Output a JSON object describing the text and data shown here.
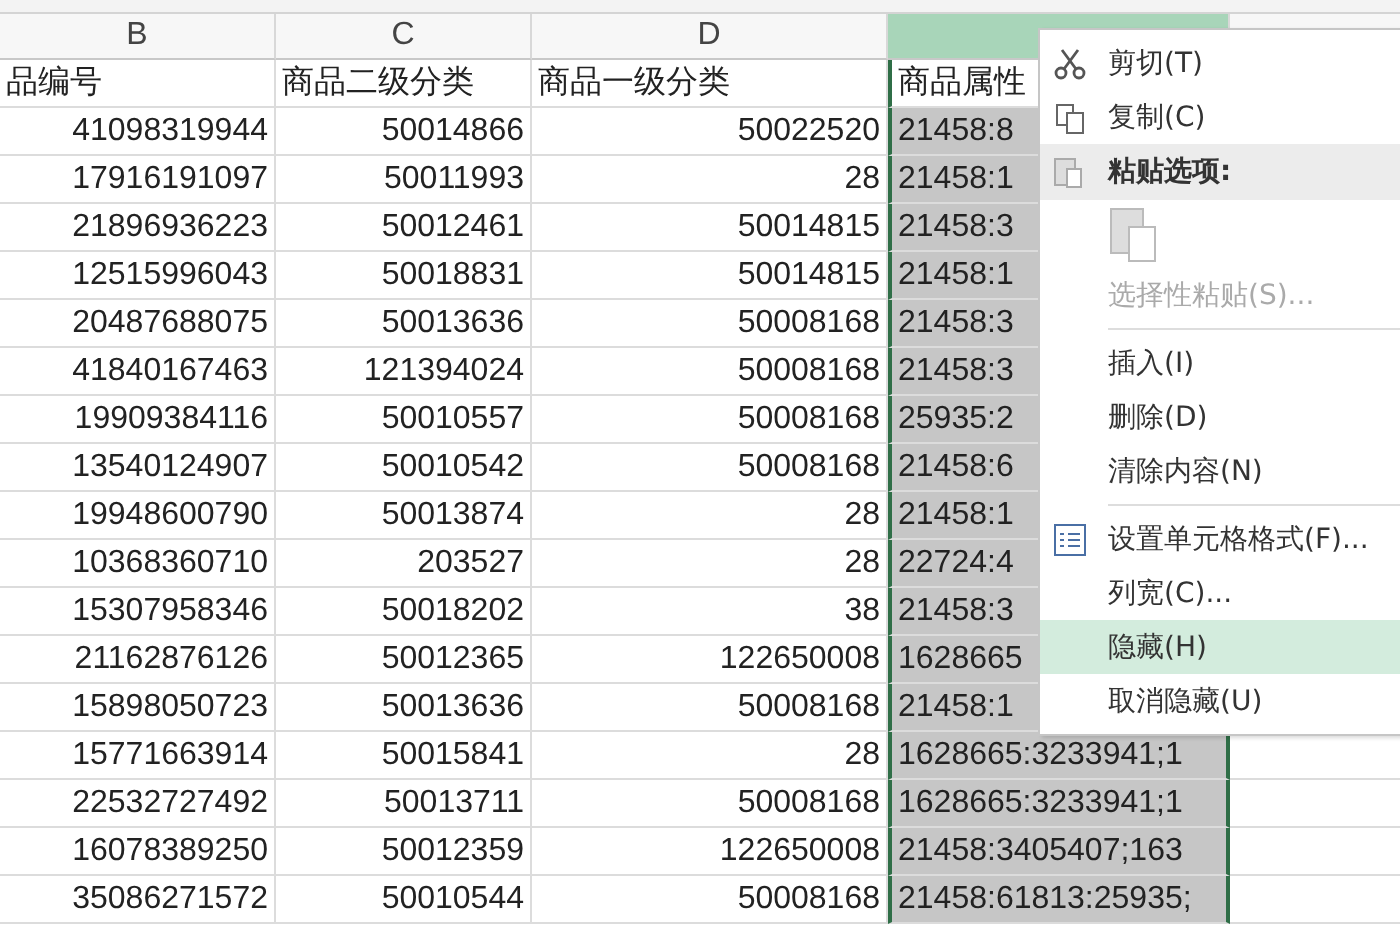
{
  "columns": [
    {
      "letter": "B",
      "selected": false
    },
    {
      "letter": "C",
      "selected": false
    },
    {
      "letter": "D",
      "selected": false
    },
    {
      "selected": true
    }
  ],
  "header_row": [
    "品编号",
    "商品二级分类",
    "商品一级分类",
    "商品属性"
  ],
  "rows": [
    [
      "41098319944",
      "50014866",
      "50022520",
      "21458:8"
    ],
    [
      "17916191097",
      "50011993",
      "28",
      "21458:1"
    ],
    [
      "21896936223",
      "50012461",
      "50014815",
      "21458:3"
    ],
    [
      "12515996043",
      "50018831",
      "50014815",
      "21458:1"
    ],
    [
      "20487688075",
      "50013636",
      "50008168",
      "21458:3"
    ],
    [
      "41840167463",
      "121394024",
      "50008168",
      "21458:3"
    ],
    [
      "19909384116",
      "50010557",
      "50008168",
      "25935:2"
    ],
    [
      "13540124907",
      "50010542",
      "50008168",
      "21458:6"
    ],
    [
      "19948600790",
      "50013874",
      "28",
      "21458:1"
    ],
    [
      "10368360710",
      "203527",
      "28",
      "22724:4"
    ],
    [
      "15307958346",
      "50018202",
      "38",
      "21458:3"
    ],
    [
      "21162876126",
      "50012365",
      "122650008",
      "1628665"
    ],
    [
      "15898050723",
      "50013636",
      "50008168",
      "21458:1"
    ],
    [
      "15771663914",
      "50015841",
      "28",
      "1628665:3233941;1"
    ],
    [
      "22532727492",
      "50013711",
      "50008168",
      "1628665:3233941;1"
    ],
    [
      "16078389250",
      "50012359",
      "122650008",
      "21458:3405407;163"
    ],
    [
      "35086271572",
      "50010544",
      "50008168",
      "21458:61813:25935;"
    ]
  ],
  "context_menu": [
    {
      "kind": "cut",
      "label": "剪切(T)",
      "disabled": false,
      "highlighted": false
    },
    {
      "kind": "copy",
      "label": "复制(C)",
      "disabled": false,
      "highlighted": false
    },
    {
      "kind": "header",
      "label": "粘贴选项:"
    },
    {
      "kind": "paste-icon",
      "disabled": true
    },
    {
      "kind": "command",
      "label": "选择性粘贴(S)...",
      "disabled": true,
      "highlighted": false
    },
    {
      "kind": "separator"
    },
    {
      "kind": "command",
      "label": "插入(I)",
      "disabled": false,
      "highlighted": false
    },
    {
      "kind": "command",
      "label": "删除(D)",
      "disabled": false,
      "highlighted": false
    },
    {
      "kind": "command",
      "label": "清除内容(N)",
      "disabled": false,
      "highlighted": false
    },
    {
      "kind": "separator"
    },
    {
      "kind": "format",
      "label": "设置单元格格式(F)...",
      "disabled": false,
      "highlighted": false
    },
    {
      "kind": "command",
      "label": "列宽(C)...",
      "disabled": false,
      "highlighted": false
    },
    {
      "kind": "command",
      "label": "隐藏(H)",
      "disabled": false,
      "highlighted": true
    },
    {
      "kind": "command",
      "label": "取消隐藏(U)",
      "disabled": false,
      "highlighted": false
    }
  ]
}
